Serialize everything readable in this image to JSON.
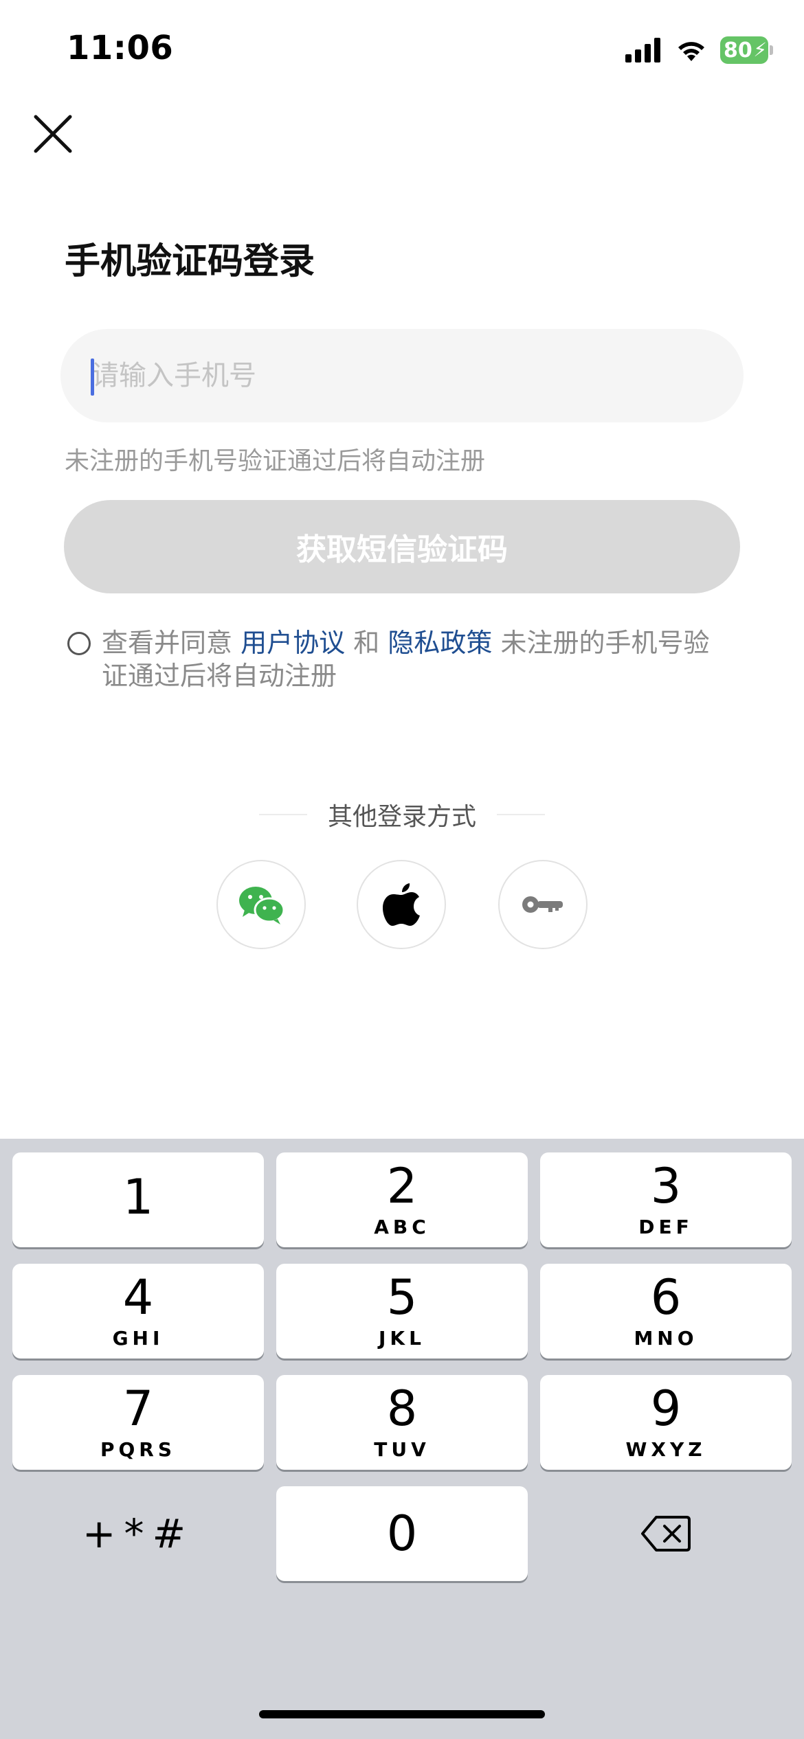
{
  "status_bar": {
    "time": "11:06",
    "battery": "80"
  },
  "page": {
    "title": "手机验证码登录",
    "phone_placeholder": "请输入手机号",
    "hint": "未注册的手机号验证通过后将自动注册",
    "sms_button": "获取短信验证码"
  },
  "agreement": {
    "prefix": "查看并同意",
    "user_agreement": "用户协议",
    "and": "和",
    "privacy_policy": "隐私政策",
    "suffix": "未注册的手机号验证通过后将自动注册"
  },
  "other_login": {
    "label": "其他登录方式",
    "methods": [
      "wechat",
      "apple",
      "key"
    ]
  },
  "keyboard": {
    "keys": [
      {
        "num": "1",
        "letters": ""
      },
      {
        "num": "2",
        "letters": "ABC"
      },
      {
        "num": "3",
        "letters": "DEF"
      },
      {
        "num": "4",
        "letters": "GHI"
      },
      {
        "num": "5",
        "letters": "JKL"
      },
      {
        "num": "6",
        "letters": "MNO"
      },
      {
        "num": "7",
        "letters": "PQRS"
      },
      {
        "num": "8",
        "letters": "TUV"
      },
      {
        "num": "9",
        "letters": "WXYZ"
      },
      {
        "num": "0",
        "letters": ""
      }
    ],
    "symbols": "+*#"
  },
  "colors": {
    "link": "#1f4e91",
    "wechat": "#3fb34f",
    "battery": "#65c466",
    "disabled_button": "#d9d9d9"
  }
}
